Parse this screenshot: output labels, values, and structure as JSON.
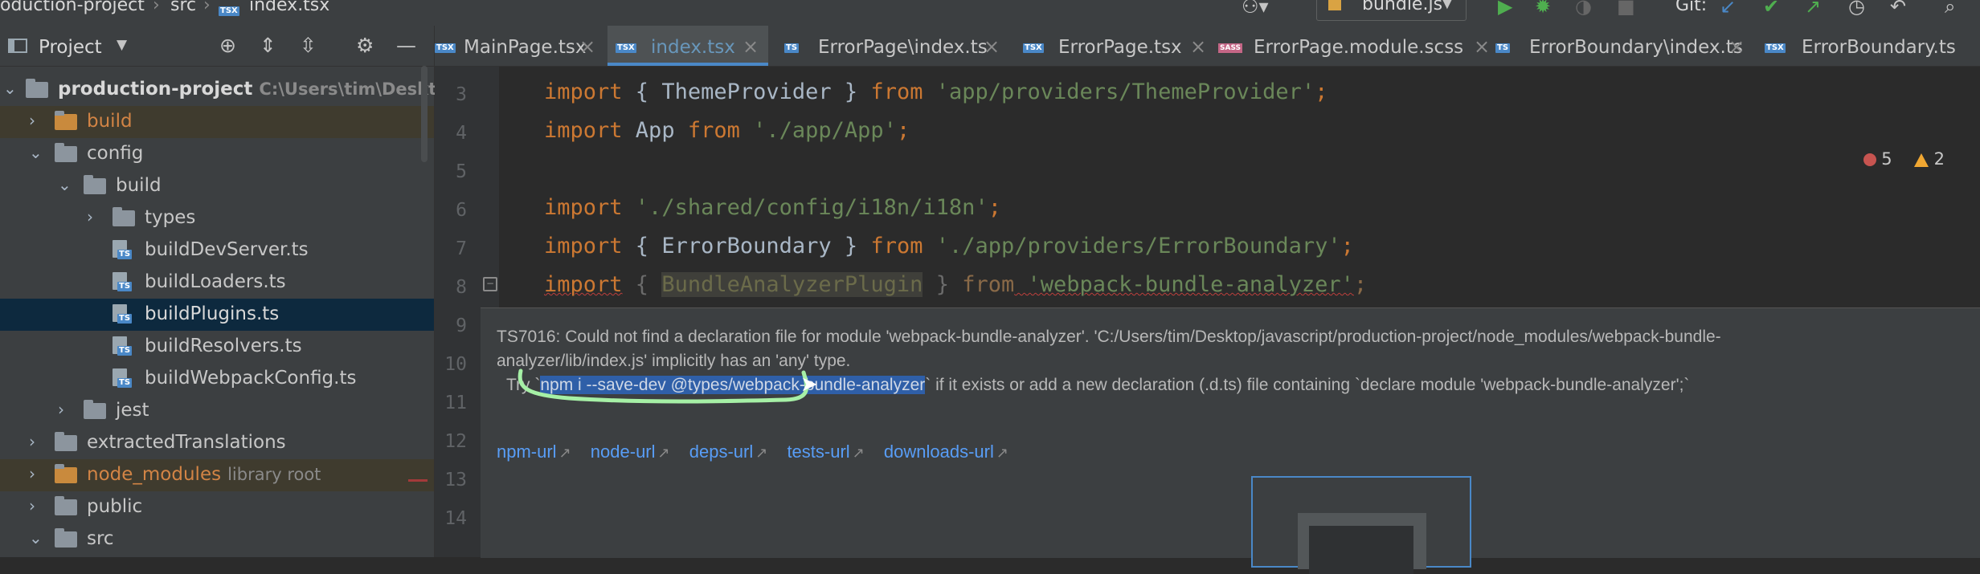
{
  "breadcrumb": [
    "oduction-project",
    "src",
    "index.tsx"
  ],
  "toolbar": {
    "run_config": "bundle.js",
    "git_label": "Git:"
  },
  "project_panel": {
    "title": "Project",
    "tree": [
      {
        "line": "3",
        "label": "production-project",
        "hint": "C:\\Users\\tim\\Desktop\\",
        "kind": "folder",
        "expanded": true,
        "style": "root"
      },
      {
        "label": "build",
        "kind": "folder",
        "expanded": false,
        "style": "orange"
      },
      {
        "label": "config",
        "kind": "folder",
        "expanded": true
      },
      {
        "label": "build",
        "kind": "folder",
        "expanded": true
      },
      {
        "label": "types",
        "kind": "folder",
        "expanded": false
      },
      {
        "label": "buildDevServer.ts",
        "kind": "ts"
      },
      {
        "label": "buildLoaders.ts",
        "kind": "ts"
      },
      {
        "label": "buildPlugins.ts",
        "kind": "ts",
        "selected": true
      },
      {
        "label": "buildResolvers.ts",
        "kind": "ts"
      },
      {
        "label": "buildWebpackConfig.ts",
        "kind": "ts"
      },
      {
        "label": "jest",
        "kind": "folder",
        "expanded": false
      },
      {
        "label": "extractedTranslations",
        "kind": "folder",
        "expanded": false
      },
      {
        "label": "node_modules",
        "hint": "library root",
        "kind": "folder",
        "expanded": false,
        "style": "orange"
      },
      {
        "label": "public",
        "kind": "folder",
        "expanded": false
      },
      {
        "label": "src",
        "kind": "folder",
        "expanded": true
      }
    ]
  },
  "tabs": [
    {
      "label": "MainPage.tsx",
      "badge": "TSX"
    },
    {
      "label": "index.tsx",
      "badge": "TSX",
      "active": true
    },
    {
      "label": "ErrorPage\\index.ts",
      "badge": "TS"
    },
    {
      "label": "ErrorPage.tsx",
      "badge": "TSX"
    },
    {
      "label": "ErrorPage.module.scss",
      "badge": "SASS"
    },
    {
      "label": "ErrorBoundary\\index.ts",
      "badge": "TS"
    },
    {
      "label": "ErrorBoundary.ts",
      "badge": "TSX"
    }
  ],
  "gutter": [
    "3",
    "4",
    "5",
    "6",
    "7",
    "8",
    "9",
    "10",
    "11",
    "12",
    "13",
    "14"
  ],
  "code": {
    "l3": {
      "kw": "import",
      "a": " { ",
      "ident": "ThemeProvider",
      "b": " } ",
      "from": "from",
      "str": " 'app/providers/ThemeProvider'",
      "end": ";"
    },
    "l4": {
      "kw": "import",
      "ident": " App ",
      "from": "from",
      "str": " './app/App'",
      "end": ";"
    },
    "l6": {
      "kw": "import",
      "str": " './shared/config/i18n/i18n'",
      "end": ";"
    },
    "l7": {
      "kw": "import",
      "a": " { ",
      "ident": "ErrorBoundary",
      "b": " } ",
      "from": "from",
      "str": " './app/providers/ErrorBoundary'",
      "end": ";"
    },
    "l8": {
      "kw": "import",
      "a": " { ",
      "ident": "BundleAnalyzerPlugin",
      "b": " } ",
      "from": "from",
      "str": " 'webpack-bundle-analyzer'",
      "end": ";"
    }
  },
  "inspections": {
    "errors": "5",
    "warnings": "2"
  },
  "tooltip": {
    "line1": "TS7016: Could not find a declaration file for module 'webpack-bundle-analyzer'. 'C:/Users/tim/Desktop/javascript/production-project/node_modules/webpack-bundle-",
    "line2": "analyzer/lib/index.js' implicitly has an 'any' type.",
    "try_prefix": "Try `",
    "try_cmd": "npm i --save-dev @types/webpack-bundle-analyzer",
    "try_suffix": "` if it exists or add a new declaration (.d.ts) file containing `declare module 'webpack-bundle-analyzer';`",
    "links": [
      "npm-url",
      "node-url",
      "deps-url",
      "tests-url",
      "downloads-url"
    ],
    "link_arrow": "↗"
  },
  "colors": {
    "accent": "#4a88c7",
    "keyword": "#cc7832",
    "string": "#6a8759",
    "link": "#589df6",
    "annotation": "#a6f0a6"
  }
}
